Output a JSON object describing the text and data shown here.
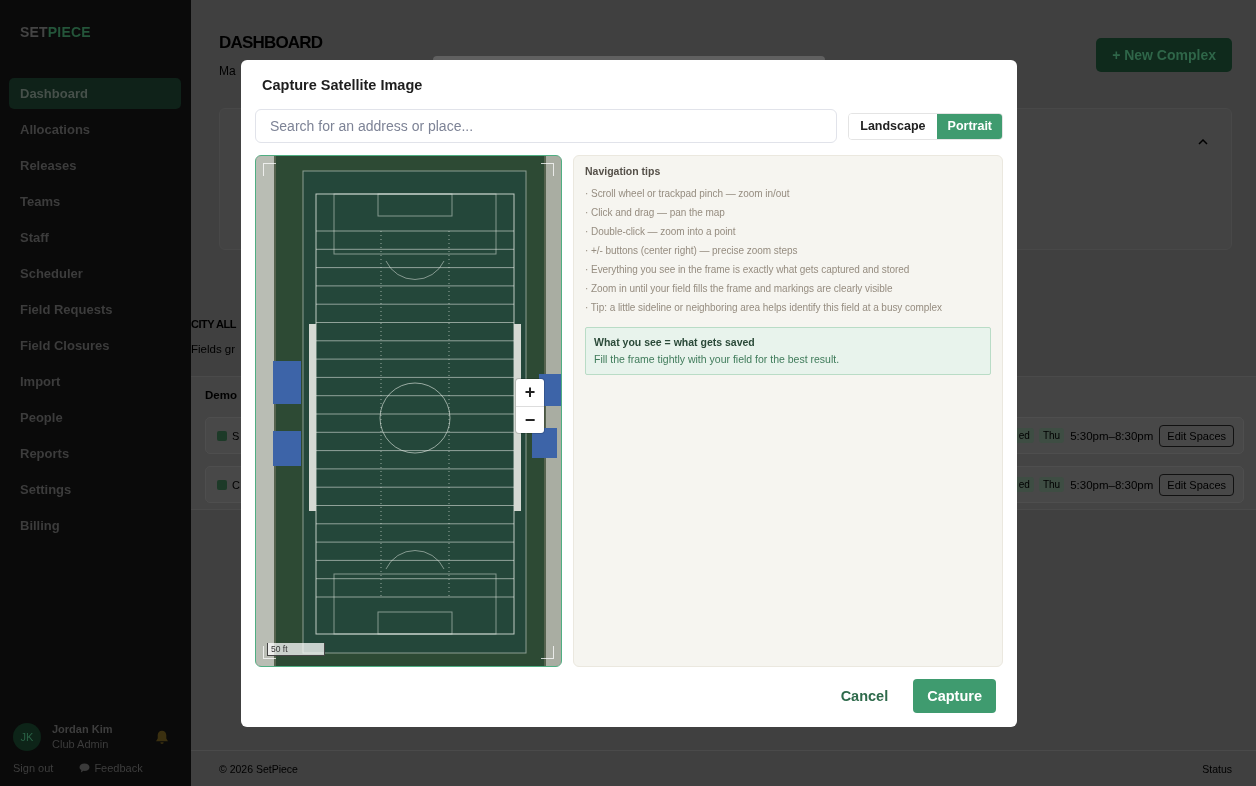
{
  "sidebar": {
    "logo": {
      "first": "SET",
      "second": "PIECE"
    },
    "items": [
      {
        "label": "Dashboard",
        "selected": true
      },
      {
        "label": "Allocations",
        "selected": false
      },
      {
        "label": "Releases",
        "selected": false
      },
      {
        "label": "Teams",
        "selected": false
      },
      {
        "label": "Staff",
        "selected": false
      },
      {
        "label": "Scheduler",
        "selected": false
      },
      {
        "label": "Field Requests",
        "selected": false
      },
      {
        "label": "Field Closures",
        "selected": false
      },
      {
        "label": "Import",
        "selected": false
      },
      {
        "label": "People",
        "selected": false
      },
      {
        "label": "Reports",
        "selected": false
      },
      {
        "label": "Settings",
        "selected": false
      },
      {
        "label": "Billing",
        "selected": false
      }
    ],
    "user": {
      "initials": "JK",
      "name": "Jordan Kim",
      "role": "Club Admin"
    },
    "links": [
      {
        "label": "Sign out",
        "kind": "signout"
      },
      {
        "label": "Feedback",
        "kind": "feedback"
      }
    ]
  },
  "page": {
    "title": "DASHBOARD",
    "subtitle": "Ma",
    "new_button": "+ New Complex",
    "summary_card": {
      "expanded": true
    },
    "section": {
      "title": "CITY ALL",
      "subtitle": "Fields gr",
      "card": {
        "label": "Demo",
        "rows": [
          {
            "name": "S",
            "color": "#1d3a28",
            "days": [
              "ed",
              "Thu"
            ],
            "time": "5:30pm–8:30pm",
            "action": "Edit Spaces"
          },
          {
            "name": "C",
            "color": "#1d3a28",
            "days": [
              "ed",
              "Thu"
            ],
            "time": "5:30pm–8:30pm",
            "action": "Edit Spaces"
          }
        ]
      }
    }
  },
  "footer": {
    "copyright": "© 2026 SetPiece",
    "status": "Status"
  },
  "modal": {
    "title": "Capture Satellite Image",
    "search": {
      "placeholder": "Search for an address or place..."
    },
    "orientations": [
      {
        "label": "Landscape",
        "selected": false
      },
      {
        "label": "Portrait",
        "selected": true
      }
    ],
    "map": {
      "zoom_in": "+",
      "zoom_out": "−",
      "scale": "50 ft"
    },
    "tips": {
      "title": "Navigation tips",
      "items": [
        "· Scroll wheel or trackpad pinch — zoom in/out",
        "· Click and drag — pan the map",
        "· Double-click — zoom into a point",
        "· +/- buttons (center right) — precise zoom steps",
        "· Everything you see in the frame is exactly what gets captured and stored",
        "· Zoom in until your field fills the frame and markings are clearly visible",
        "· Tip: a little sideline or neighboring area helps identify this field at a busy complex"
      ]
    },
    "callout": {
      "title": "What you see = what gets saved",
      "text": "Fill the frame tightly with your field for the best result."
    },
    "buttons": [
      {
        "label": "Cancel",
        "kind": "secondary"
      },
      {
        "label": "Capture",
        "kind": "primary"
      }
    ]
  }
}
